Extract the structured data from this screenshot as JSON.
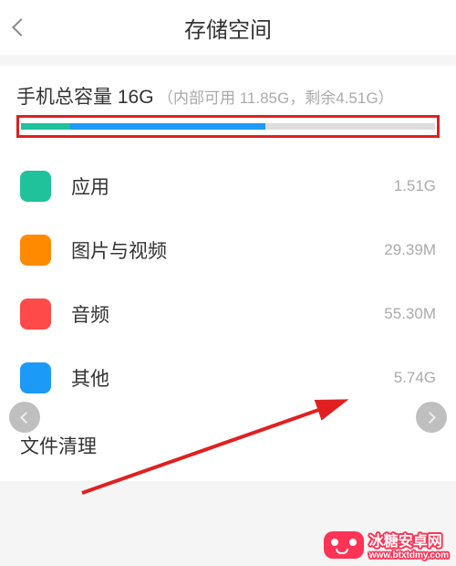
{
  "header": {
    "title": "存储空间"
  },
  "summary": {
    "title_prefix": "手机总容量 ",
    "total": "16G",
    "detail": "（内部可用 11.85G，剩余4.51G）"
  },
  "categories": [
    {
      "label": "应用",
      "size": "1.51G",
      "color": "#1fc29a"
    },
    {
      "label": "图片与视频",
      "size": "29.39M",
      "color": "#ff8a00"
    },
    {
      "label": "音频",
      "size": "55.30M",
      "color": "#ff4a4a"
    },
    {
      "label": "其他",
      "size": "5.74G",
      "color": "#1b9af7"
    }
  ],
  "cleanup": {
    "label": "文件清理"
  },
  "watermark": {
    "text": "冰糖安卓网",
    "url": "www.btxtdmy.com"
  }
}
